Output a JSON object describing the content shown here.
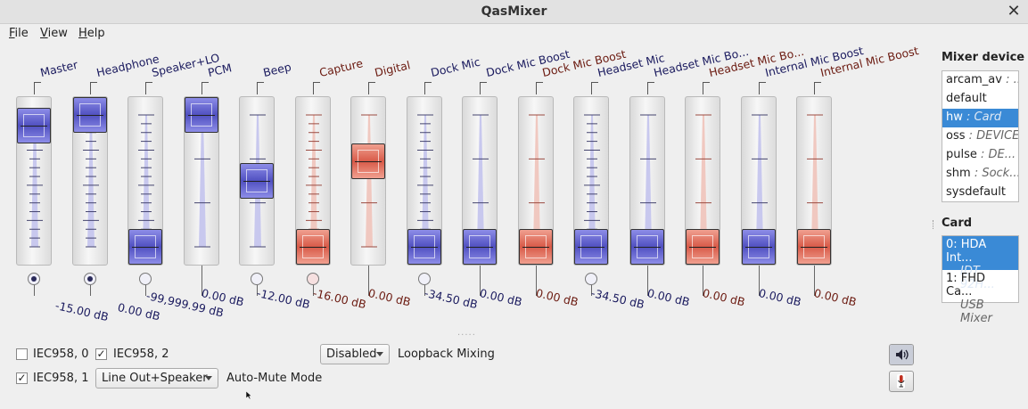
{
  "window": {
    "title": "QasMixer"
  },
  "menu": [
    {
      "label": "File",
      "accel": "F",
      "rest": "ile"
    },
    {
      "label": "View",
      "accel": "V",
      "rest": "iew"
    },
    {
      "label": "Help",
      "accel": "H",
      "rest": "elp"
    }
  ],
  "colors": {
    "playback": "#1a1a5e",
    "capture": "#6b1a10",
    "selection": "#3a8ad6"
  },
  "channels": [
    {
      "name": "Master",
      "type": "playback",
      "level": 0.92,
      "value": "-15.00 dB",
      "switch": "on"
    },
    {
      "name": "Headphone",
      "type": "playback",
      "level": 1.0,
      "value": "0.00 dB",
      "switch": "on"
    },
    {
      "name": "Speaker+LO",
      "type": "playback",
      "level": 0.0,
      "value": "-99,999.99 dB",
      "switch": "off"
    },
    {
      "name": "PCM",
      "type": "playback",
      "level": 1.0,
      "value": "0.00 dB",
      "switch": "none"
    },
    {
      "name": "Beep",
      "type": "playback",
      "level": 0.5,
      "value": "-12.00 dB",
      "switch": "off"
    },
    {
      "name": "Capture",
      "type": "capture",
      "level": 0.0,
      "value": "-16.00 dB",
      "switch": "off"
    },
    {
      "name": "Digital",
      "type": "capture",
      "level": 0.65,
      "value": "0.00 dB",
      "switch": "none"
    },
    {
      "name": "Dock Mic",
      "type": "playback",
      "level": 0.0,
      "value": "-34.50 dB",
      "switch": "off"
    },
    {
      "name": "Dock Mic Boost",
      "type": "playback",
      "level": 0.0,
      "value": "0.00 dB",
      "switch": "none"
    },
    {
      "name": "Dock Mic Boost",
      "type": "capture",
      "level": 0.0,
      "value": "0.00 dB",
      "switch": "none"
    },
    {
      "name": "Headset Mic",
      "type": "playback",
      "level": 0.0,
      "value": "-34.50 dB",
      "switch": "off"
    },
    {
      "name": "Headset Mic Bo...",
      "type": "playback",
      "level": 0.0,
      "value": "0.00 dB",
      "switch": "none"
    },
    {
      "name": "Headset Mic Bo...",
      "type": "capture",
      "level": 0.0,
      "value": "0.00 dB",
      "switch": "none"
    },
    {
      "name": "Internal Mic Boost",
      "type": "playback",
      "level": 0.0,
      "value": "0.00 dB",
      "switch": "none"
    },
    {
      "name": "Internal Mic Boost",
      "type": "capture",
      "level": 0.0,
      "value": "0.00 dB",
      "switch": "none"
    }
  ],
  "sidebar": {
    "device_title": "Mixer device",
    "devices": [
      {
        "name": "arcam_av",
        "desc": "...",
        "selected": false
      },
      {
        "name": "default",
        "desc": "",
        "selected": false
      },
      {
        "name": "hw",
        "desc": "Card",
        "selected": true
      },
      {
        "name": "oss",
        "desc": "DEVICE",
        "selected": false
      },
      {
        "name": "pulse",
        "desc": "DE...",
        "selected": false
      },
      {
        "name": "shm",
        "desc": "Sock...",
        "selected": false
      },
      {
        "name": "sysdefault",
        "desc": "",
        "selected": false
      }
    ],
    "card_title": "Card",
    "cards": [
      {
        "name": "0: HDA Int...",
        "desc": "IDT 92H...",
        "selected": true
      },
      {
        "name": "1: FHD Ca...",
        "desc": "USB Mixer",
        "selected": false
      }
    ]
  },
  "switches": {
    "iec958_0": {
      "label": "IEC958, 0",
      "checked": false
    },
    "iec958_2": {
      "label": "IEC958, 2",
      "checked": true
    },
    "iec958_1": {
      "label": "IEC958, 1",
      "checked": true
    }
  },
  "enums": {
    "loopback": {
      "value": "Disabled",
      "label": "Loopback Mixing"
    },
    "automute": {
      "value": "Line Out+Speaker",
      "label": "Auto-Mute Mode"
    }
  },
  "icons": {
    "playback": "speaker-icon",
    "capture": "microphone-icon"
  },
  "separator_dots": "....."
}
